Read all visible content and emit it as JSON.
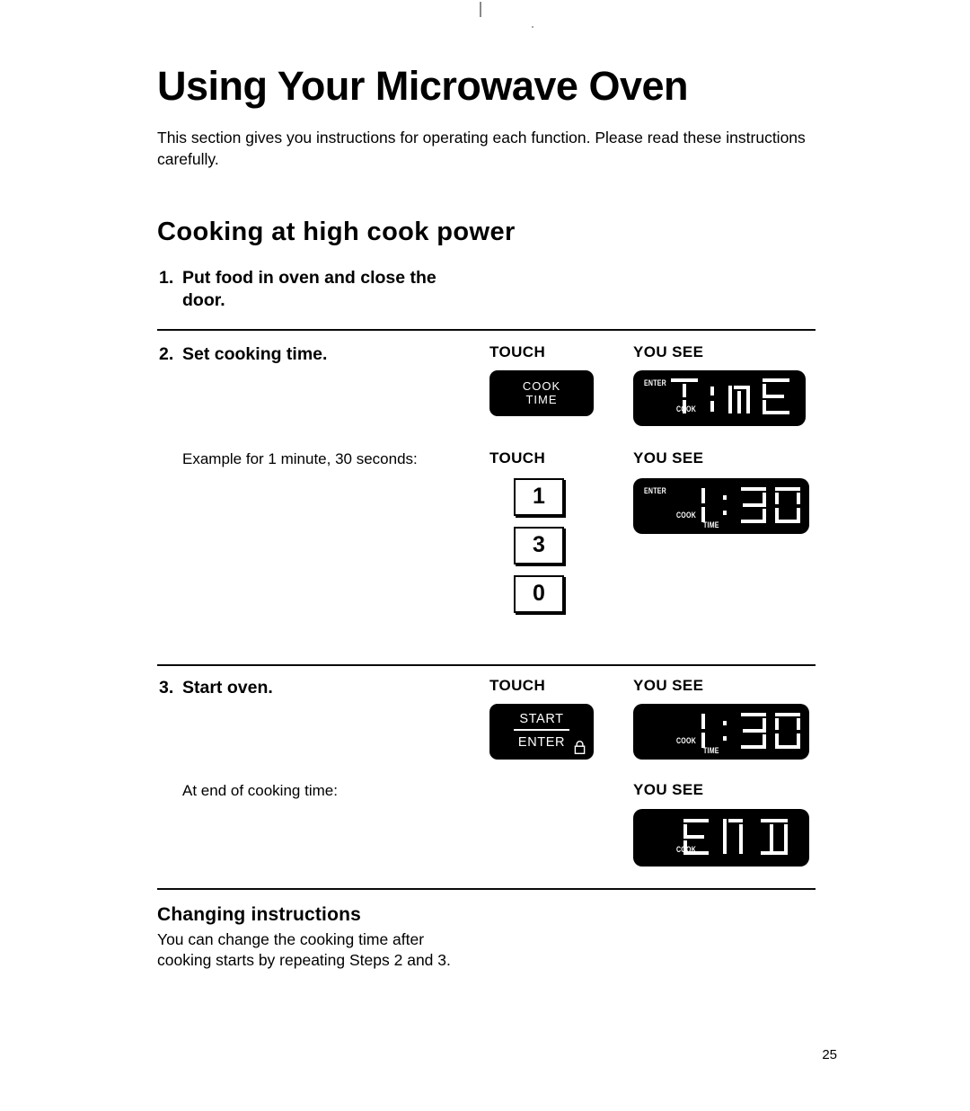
{
  "document": {
    "title": "Using Your Microwave Oven",
    "intro": "This section gives you instructions for operating each function. Please read these instructions carefully.",
    "page_number": "25"
  },
  "section": {
    "heading": "Cooking at high cook power",
    "column_headers": {
      "touch": "TOUCH",
      "you_see": "YOU SEE"
    },
    "steps": [
      {
        "number": "1.",
        "text": "Put food in oven and close the door."
      },
      {
        "number": "2.",
        "text": "Set cooking time.",
        "touch_label": "TOUCH",
        "you_see_label": "YOU SEE",
        "button": {
          "line1": "COOK",
          "line2": "TIME"
        },
        "display": {
          "value": "TIME",
          "indicators": [
            "ENTER",
            "COOK"
          ]
        }
      },
      {
        "number": "3.",
        "text": "Start oven.",
        "touch_label": "TOUCH",
        "you_see_label": "YOU SEE",
        "button": {
          "line1": "START",
          "line2": "ENTER",
          "icon": "lock-icon"
        },
        "display": {
          "value": "1:30",
          "indicators": [
            "COOK",
            "TIME"
          ]
        }
      }
    ],
    "example": {
      "caption": "Example for 1 minute, 30 seconds:",
      "touch_label": "TOUCH",
      "you_see_label": "YOU SEE",
      "keys": [
        "1",
        "3",
        "0"
      ],
      "display": {
        "value": "1:30",
        "indicators": [
          "ENTER",
          "COOK",
          "TIME"
        ]
      }
    },
    "end_of_cooking": {
      "caption": "At end of cooking time:",
      "you_see_label": "YOU SEE",
      "display": {
        "value": "END",
        "indicators": [
          "COOK"
        ]
      }
    }
  },
  "changing_instructions": {
    "heading": "Changing instructions",
    "body": "You can change the cooking time after cooking starts by repeating Steps 2 and 3."
  }
}
